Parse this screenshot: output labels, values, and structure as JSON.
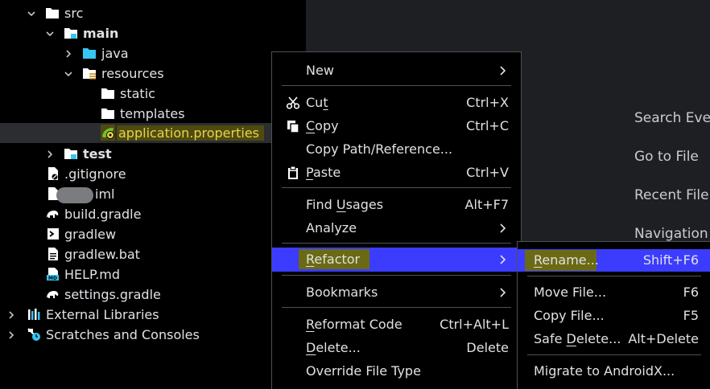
{
  "tree": {
    "rows": [
      {
        "label": "src"
      },
      {
        "label": "main"
      },
      {
        "label": "java"
      },
      {
        "label": "resources"
      },
      {
        "label": "static"
      },
      {
        "label": "templates"
      },
      {
        "label": "application.properties"
      },
      {
        "label": "test"
      },
      {
        "label": ".gitignore"
      },
      {
        "label": "iml"
      },
      {
        "label": "build.gradle"
      },
      {
        "label": "gradlew"
      },
      {
        "label": "gradlew.bat"
      },
      {
        "label": "HELP.md"
      },
      {
        "label": "settings.gradle"
      },
      {
        "label": "External Libraries"
      },
      {
        "label": "Scratches and Consoles"
      }
    ]
  },
  "welcome": {
    "items": [
      "Search Eve",
      "Go to File",
      "Recent File",
      "Navigation"
    ]
  },
  "context_menu": {
    "new": "New",
    "cut_pre": "Cu",
    "cut_u": "t",
    "cut_shortcut": "Ctrl+X",
    "copy_u": "C",
    "copy_post": "opy",
    "copy_shortcut": "Ctrl+C",
    "copy_path": "Copy Path/Reference...",
    "paste_u": "P",
    "paste_post": "aste",
    "paste_shortcut": "Ctrl+V",
    "find_pre": "Find ",
    "find_u": "U",
    "find_post": "sages",
    "find_shortcut": "Alt+F7",
    "analyze": "Analyze",
    "refactor_u": "R",
    "refactor_post": "efactor",
    "bookmarks": "Bookmarks",
    "reformat_u": "R",
    "reformat_post": "eformat Code",
    "reformat_shortcut": "Ctrl+Alt+L",
    "delete_u": "D",
    "delete_post": "elete...",
    "delete_shortcut": "Delete",
    "override": "Override File Type"
  },
  "refactor_submenu": {
    "rename_u": "R",
    "rename_post": "ename...",
    "rename_shortcut": "Shift+F6",
    "move": "Move File...",
    "move_shortcut": "F6",
    "copy": "Copy File...",
    "copy_shortcut": "F5",
    "safe_pre": "Safe ",
    "safe_u": "D",
    "safe_post": "elete...",
    "safe_shortcut": "Alt+Delete",
    "migrate": "Migrate to AndroidX..."
  },
  "colors": {
    "menu_highlight": "#3c3cff",
    "label_highlight": "#6b6a14",
    "folder_blue": "#35c6f4"
  }
}
